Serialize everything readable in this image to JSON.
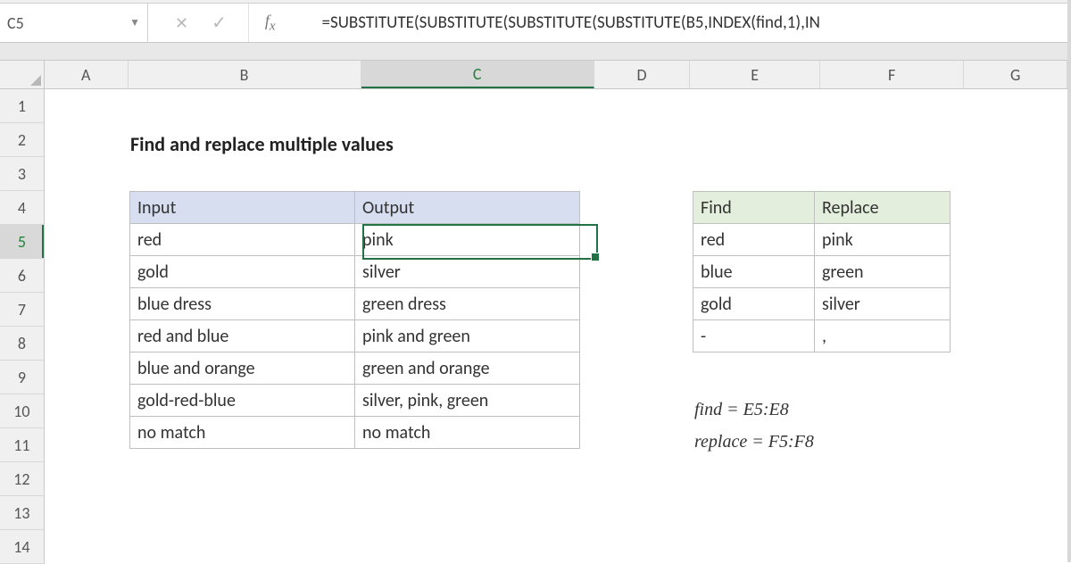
{
  "name_box": "C5",
  "formula": "=SUBSTITUTE(SUBSTITUTE(SUBSTITUTE(SUBSTITUTE(B5,INDEX(find,1),IN",
  "columns": [
    "A",
    "B",
    "C",
    "D",
    "E",
    "F",
    "G"
  ],
  "active_column": "C",
  "row_count": 14,
  "active_row": 5,
  "title": "Find and replace multiple values",
  "table1": {
    "headers": {
      "input": "Input",
      "output": "Output"
    },
    "rows": [
      {
        "input": "red",
        "output": "pink"
      },
      {
        "input": "gold",
        "output": "silver"
      },
      {
        "input": "blue dress",
        "output": "green dress"
      },
      {
        "input": "red and blue",
        "output": "pink and green"
      },
      {
        "input": "blue and orange",
        "output": "green and orange"
      },
      {
        "input": "gold-red-blue",
        "output": "silver, pink, green"
      },
      {
        "input": "no match",
        "output": "no match"
      }
    ]
  },
  "table2": {
    "headers": {
      "find": "Find",
      "replace": "Replace"
    },
    "rows": [
      {
        "find": "red",
        "replace": "pink"
      },
      {
        "find": "blue",
        "replace": "green"
      },
      {
        "find": "gold",
        "replace": "silver"
      },
      {
        "find": "-",
        "replace": ","
      }
    ]
  },
  "notes": {
    "n1": "find = E5:E8",
    "n2": "replace = F5:F8"
  }
}
